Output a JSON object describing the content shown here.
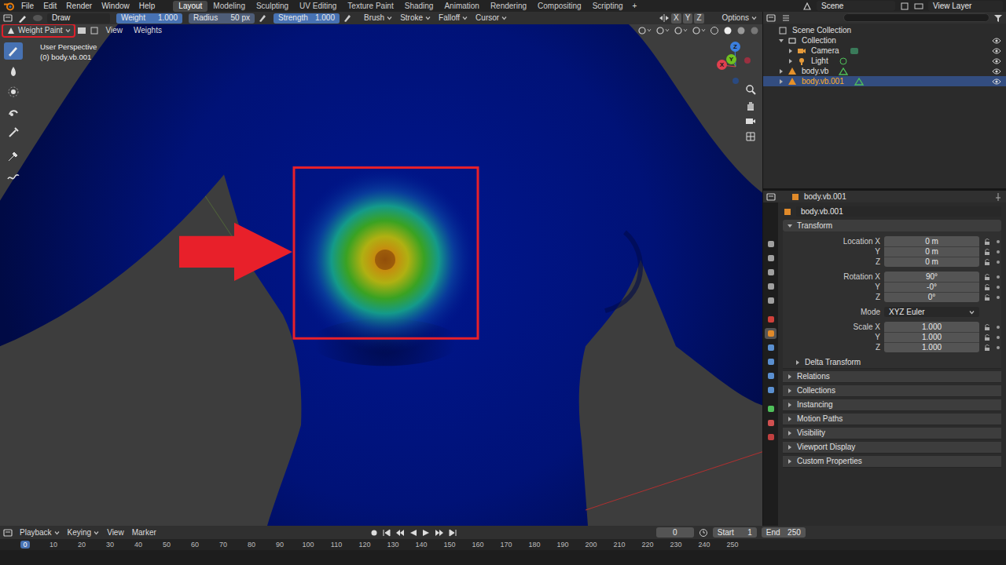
{
  "menu_bar": {
    "menus": [
      "File",
      "Edit",
      "Render",
      "Window",
      "Help"
    ],
    "workspaces": [
      {
        "label": "Layout",
        "selected": true
      },
      {
        "label": "Modeling",
        "selected": false
      },
      {
        "label": "Sculpting",
        "selected": false
      },
      {
        "label": "UV Editing",
        "selected": false
      },
      {
        "label": "Texture Paint",
        "selected": false
      },
      {
        "label": "Shading",
        "selected": false
      },
      {
        "label": "Animation",
        "selected": false
      },
      {
        "label": "Rendering",
        "selected": false
      },
      {
        "label": "Compositing",
        "selected": false
      },
      {
        "label": "Scripting",
        "selected": false
      }
    ],
    "add_workspace": "+",
    "scene": "Scene",
    "view_layer": "View Layer"
  },
  "tool_header": {
    "tool": "Draw",
    "fields": [
      {
        "label": "Weight",
        "value": "1.000",
        "level": 1
      },
      {
        "label": "Radius",
        "value": "50 px"
      },
      {
        "label": "Strength",
        "value": "1.000",
        "level": 1
      }
    ],
    "menus": [
      "Brush",
      "Stroke",
      "Falloff",
      "Cursor"
    ],
    "axes": [
      "X",
      "Y",
      "Z"
    ],
    "options": "Options"
  },
  "viewport": {
    "mode": "Weight Paint",
    "menus": [
      "View",
      "Weights"
    ],
    "info": [
      "User Perspective",
      "(0) body.vb.001"
    ],
    "tools": [
      {
        "selected": true
      },
      {
        "selected": false
      },
      {
        "selected": false
      },
      {
        "selected": false
      },
      {
        "selected": false
      },
      {
        "selected": false
      },
      {
        "selected": false
      }
    ],
    "gizmo": [
      {
        "label": "Z",
        "color": "#3b7fe0"
      },
      {
        "label": "Y",
        "color": "#70c020"
      },
      {
        "label": "X",
        "color": "#e0404f"
      }
    ]
  },
  "outliner": {
    "items": [
      {
        "label": "Scene Collection",
        "depth": 0,
        "kind": "scene",
        "expanded": true,
        "selected": false,
        "visible": false
      },
      {
        "label": "Collection",
        "depth": 1,
        "kind": "collection",
        "expanded": true,
        "selected": false,
        "visible": true
      },
      {
        "label": "Camera",
        "depth": 2,
        "kind": "camera",
        "expanded": false,
        "selected": false,
        "visible": true
      },
      {
        "label": "Light",
        "depth": 2,
        "kind": "light",
        "expanded": false,
        "selected": false,
        "visible": true
      },
      {
        "label": "body.vb",
        "depth": 1,
        "kind": "mesh",
        "expanded": false,
        "selected": false,
        "visible": true
      },
      {
        "label": "body.vb.001",
        "depth": 1,
        "kind": "mesh",
        "expanded": false,
        "selected": true,
        "visible": true
      }
    ]
  },
  "properties": {
    "header": "body.vb.001",
    "object_name": "body.vb.001",
    "tabs": [
      {
        "selected": false,
        "color": "#a0a0a0"
      },
      {
        "selected": false,
        "color": "#a0a0a0"
      },
      {
        "selected": false,
        "color": "#a0a0a0"
      },
      {
        "selected": false,
        "color": "#a0a0a0"
      },
      {
        "selected": false,
        "color": "#a0a0a0"
      },
      {
        "selected": false,
        "color": "#d0403a"
      },
      {
        "selected": true,
        "color": "#e08a2a"
      },
      {
        "selected": false,
        "color": "#5a8fd0"
      },
      {
        "selected": false,
        "color": "#5a8fd0"
      },
      {
        "selected": false,
        "color": "#5a8fd0"
      },
      {
        "selected": false,
        "color": "#5a8fd0"
      },
      {
        "selected": false,
        "color": "#4fc05a"
      },
      {
        "selected": false,
        "color": "#d05050"
      },
      {
        "selected": false,
        "color": "#c04040"
      }
    ],
    "transform": {
      "label": "Transform",
      "expanded": true,
      "groups": [
        [
          {
            "label": "Location X",
            "value": "0 m",
            "kind": "field"
          },
          {
            "label": "Y",
            "value": "0 m",
            "kind": "field"
          },
          {
            "label": "Z",
            "value": "0 m",
            "kind": "field"
          }
        ],
        [
          {
            "label": "Rotation X",
            "value": "90°",
            "kind": "field"
          },
          {
            "label": "Y",
            "value": "-0°",
            "kind": "field"
          },
          {
            "label": "Z",
            "value": "0°",
            "kind": "field"
          }
        ],
        [
          {
            "label": "Mode",
            "value": "XYZ Euler",
            "kind": "dropdown"
          }
        ],
        [
          {
            "label": "Scale X",
            "value": "1.000",
            "kind": "field"
          },
          {
            "label": "Y",
            "value": "1.000",
            "kind": "field"
          },
          {
            "label": "Z",
            "value": "1.000",
            "kind": "field"
          }
        ]
      ]
    },
    "panels": [
      {
        "label": "Delta Transform",
        "expanded": false,
        "kind": "subpanel"
      },
      {
        "label": "Relations",
        "expanded": false,
        "kind": "panel"
      },
      {
        "label": "Collections",
        "expanded": false,
        "kind": "panel"
      },
      {
        "label": "Instancing",
        "expanded": false,
        "kind": "panel"
      },
      {
        "label": "Motion Paths",
        "expanded": false,
        "kind": "panel"
      },
      {
        "label": "Visibility",
        "expanded": false,
        "kind": "panel"
      },
      {
        "label": "Viewport Display",
        "expanded": false,
        "kind": "panel"
      },
      {
        "label": "Custom Properties",
        "expanded": false,
        "kind": "panel"
      }
    ]
  },
  "timeline": {
    "menus": [
      "Playback",
      "Keying",
      "View",
      "Marker"
    ],
    "current_frame": "0",
    "start_label": "Start",
    "start": "1",
    "end_label": "End",
    "end": "250",
    "ticks": [
      "0",
      "10",
      "20",
      "30",
      "40",
      "50",
      "60",
      "70",
      "80",
      "90",
      "100",
      "110",
      "120",
      "130",
      "140",
      "150",
      "160",
      "170",
      "180",
      "190",
      "200",
      "210",
      "220",
      "230",
      "240",
      "250"
    ]
  }
}
